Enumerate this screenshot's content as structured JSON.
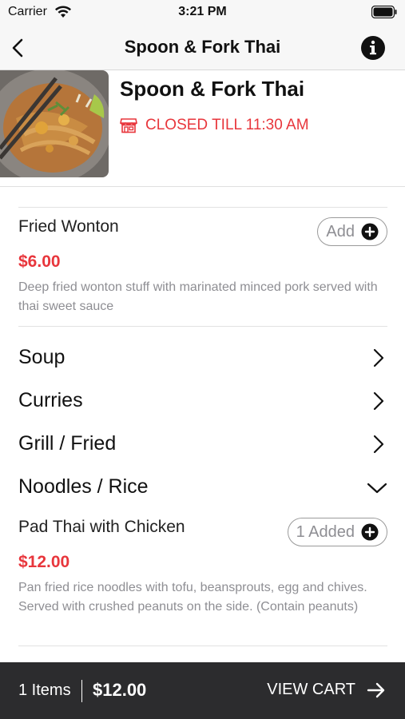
{
  "status_bar": {
    "carrier": "Carrier",
    "time": "3:21 PM"
  },
  "nav": {
    "title": "Spoon & Fork Thai"
  },
  "restaurant": {
    "name": "Spoon & Fork Thai",
    "status": "CLOSED TILL 11:30 AM"
  },
  "items": [
    {
      "name": "Fried Wonton",
      "price": "$6.00",
      "description": "Deep fried wonton stuff with marinated minced pork served with thai sweet sauce",
      "button_label": "Add"
    },
    {
      "name": "Pad Thai with Chicken",
      "price": "$12.00",
      "description": "Pan fried rice noodles with  tofu, beansprouts, egg and chives. Served with crushed peanuts on the side. (Contain peanuts)",
      "button_label": "1 Added"
    }
  ],
  "categories": [
    {
      "label": "Soup",
      "state": "collapsed"
    },
    {
      "label": "Curries",
      "state": "collapsed"
    },
    {
      "label": "Grill / Fried",
      "state": "collapsed"
    },
    {
      "label": "Noodles / Rice",
      "state": "expanded"
    }
  ],
  "cart": {
    "count": "1 Items",
    "total": "$12.00",
    "action": "VIEW CART"
  },
  "colors": {
    "accent_red": "#e8363c",
    "cart_bar": "#2c2c2e",
    "nav_bg": "#f7f7f7"
  },
  "icons": [
    "wifi-icon",
    "battery-icon",
    "back-chevron-icon",
    "info-icon",
    "store-icon",
    "plus-icon",
    "chevron-right-icon",
    "chevron-down-icon",
    "arrow-right-icon"
  ]
}
